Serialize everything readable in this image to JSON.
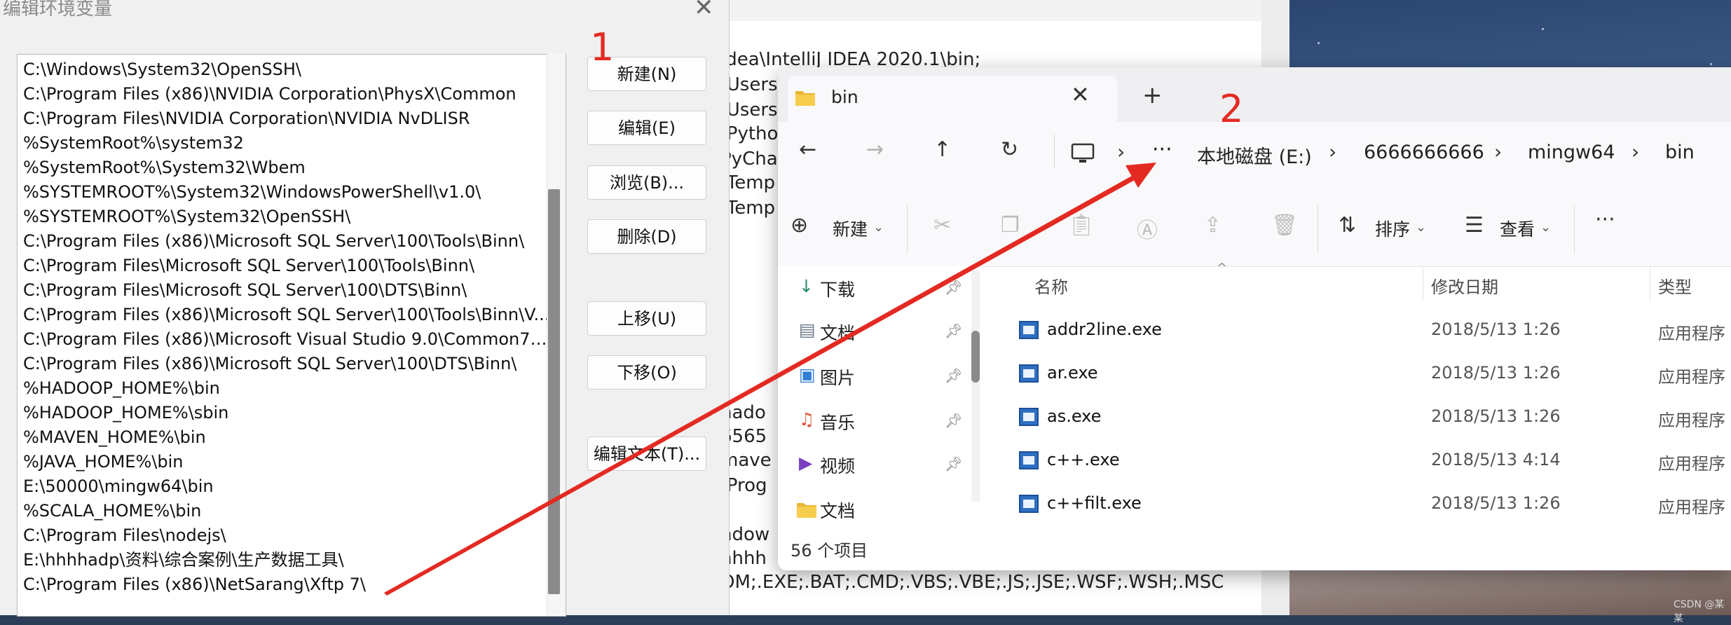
{
  "env_dialog": {
    "title": "编辑环境变量",
    "paths": [
      "C:\\Windows\\System32\\OpenSSH\\",
      "C:\\Program Files (x86)\\NVIDIA Corporation\\PhysX\\Common",
      "C:\\Program Files\\NVIDIA Corporation\\NVIDIA NvDLISR",
      "%SystemRoot%\\system32",
      "%SystemRoot%\\System32\\Wbem",
      "%SYSTEMROOT%\\System32\\WindowsPowerShell\\v1.0\\",
      "%SYSTEMROOT%\\System32\\OpenSSH\\",
      "C:\\Program Files (x86)\\Microsoft SQL Server\\100\\Tools\\Binn\\",
      "C:\\Program Files\\Microsoft SQL Server\\100\\Tools\\Binn\\",
      "C:\\Program Files\\Microsoft SQL Server\\100\\DTS\\Binn\\",
      "C:\\Program Files (x86)\\Microsoft SQL Server\\100\\Tools\\Binn\\V...",
      "C:\\Program Files (x86)\\Microsoft Visual Studio 9.0\\Common7\\I...",
      "C:\\Program Files (x86)\\Microsoft SQL Server\\100\\DTS\\Binn\\",
      "%HADOOP_HOME%\\bin",
      "%HADOOP_HOME%\\sbin",
      "%MAVEN_HOME%\\bin",
      "%JAVA_HOME%\\bin",
      "E:\\50000\\mingw64\\bin",
      "%SCALA_HOME%\\bin",
      "C:\\Program Files\\nodejs\\",
      "E:\\hhhhadp\\资料\\综合案例\\生产数据工具\\",
      "C:\\Program Files (x86)\\NetSarang\\Xftp 7\\"
    ],
    "buttons": {
      "new": "新建(N)",
      "edit": "编辑(E)",
      "browse": "浏览(B)...",
      "delete": "删除(D)",
      "move_up": "上移(U)",
      "move_down": "下移(O)",
      "edit_text": "编辑文本(T)..."
    }
  },
  "background_window": {
    "lines": [
      "idea\\IntelliJ IDEA 2020.1\\bin;",
      "\\Users",
      "\\Users",
      "\\Pytho",
      "PyCha",
      "\\Temp",
      "\\Temp",
      "hado",
      "6565",
      "mave",
      "\\Prog",
      "ndow",
      "hhhh",
      "OM;.EXE;.BAT;.CMD;.VBS;.VBE;.JS;.JSE;.WSF;.WSH;.MSC"
    ]
  },
  "explorer": {
    "tab_title": "bin",
    "breadcrumb": [
      "本地磁盘 (E:)",
      "6666666666",
      "mingw64",
      "bin"
    ],
    "toolbar": {
      "new_label": "新建",
      "sort_label": "排序",
      "view_label": "查看"
    },
    "sidebar": [
      {
        "label": "下载",
        "icon": "download-icon",
        "color": "#2a8f6a"
      },
      {
        "label": "文档",
        "icon": "document-icon",
        "color": "#6d7a8c"
      },
      {
        "label": "图片",
        "icon": "picture-icon",
        "color": "#2f7fd4"
      },
      {
        "label": "音乐",
        "icon": "music-icon",
        "color": "#e0573a"
      },
      {
        "label": "视频",
        "icon": "video-icon",
        "color": "#7b3fc2"
      },
      {
        "label": "文档",
        "icon": "folder-icon",
        "color": "#e9b633"
      }
    ],
    "columns": {
      "name": "名称",
      "modified": "修改日期",
      "type": "类型"
    },
    "files": [
      {
        "name": "addr2line.exe",
        "date": "2018/5/13 1:26",
        "type": "应用程序"
      },
      {
        "name": "ar.exe",
        "date": "2018/5/13 1:26",
        "type": "应用程序"
      },
      {
        "name": "as.exe",
        "date": "2018/5/13 1:26",
        "type": "应用程序"
      },
      {
        "name": "c++.exe",
        "date": "2018/5/13 4:14",
        "type": "应用程序"
      },
      {
        "name": "c++filt.exe",
        "date": "2018/5/13 1:26",
        "type": "应用程序"
      }
    ],
    "item_count": "56 个项目"
  },
  "annotations": {
    "step1": "1",
    "step2": "2",
    "arrow_color": "#e32a22"
  },
  "watermark": "CSDN @某某"
}
